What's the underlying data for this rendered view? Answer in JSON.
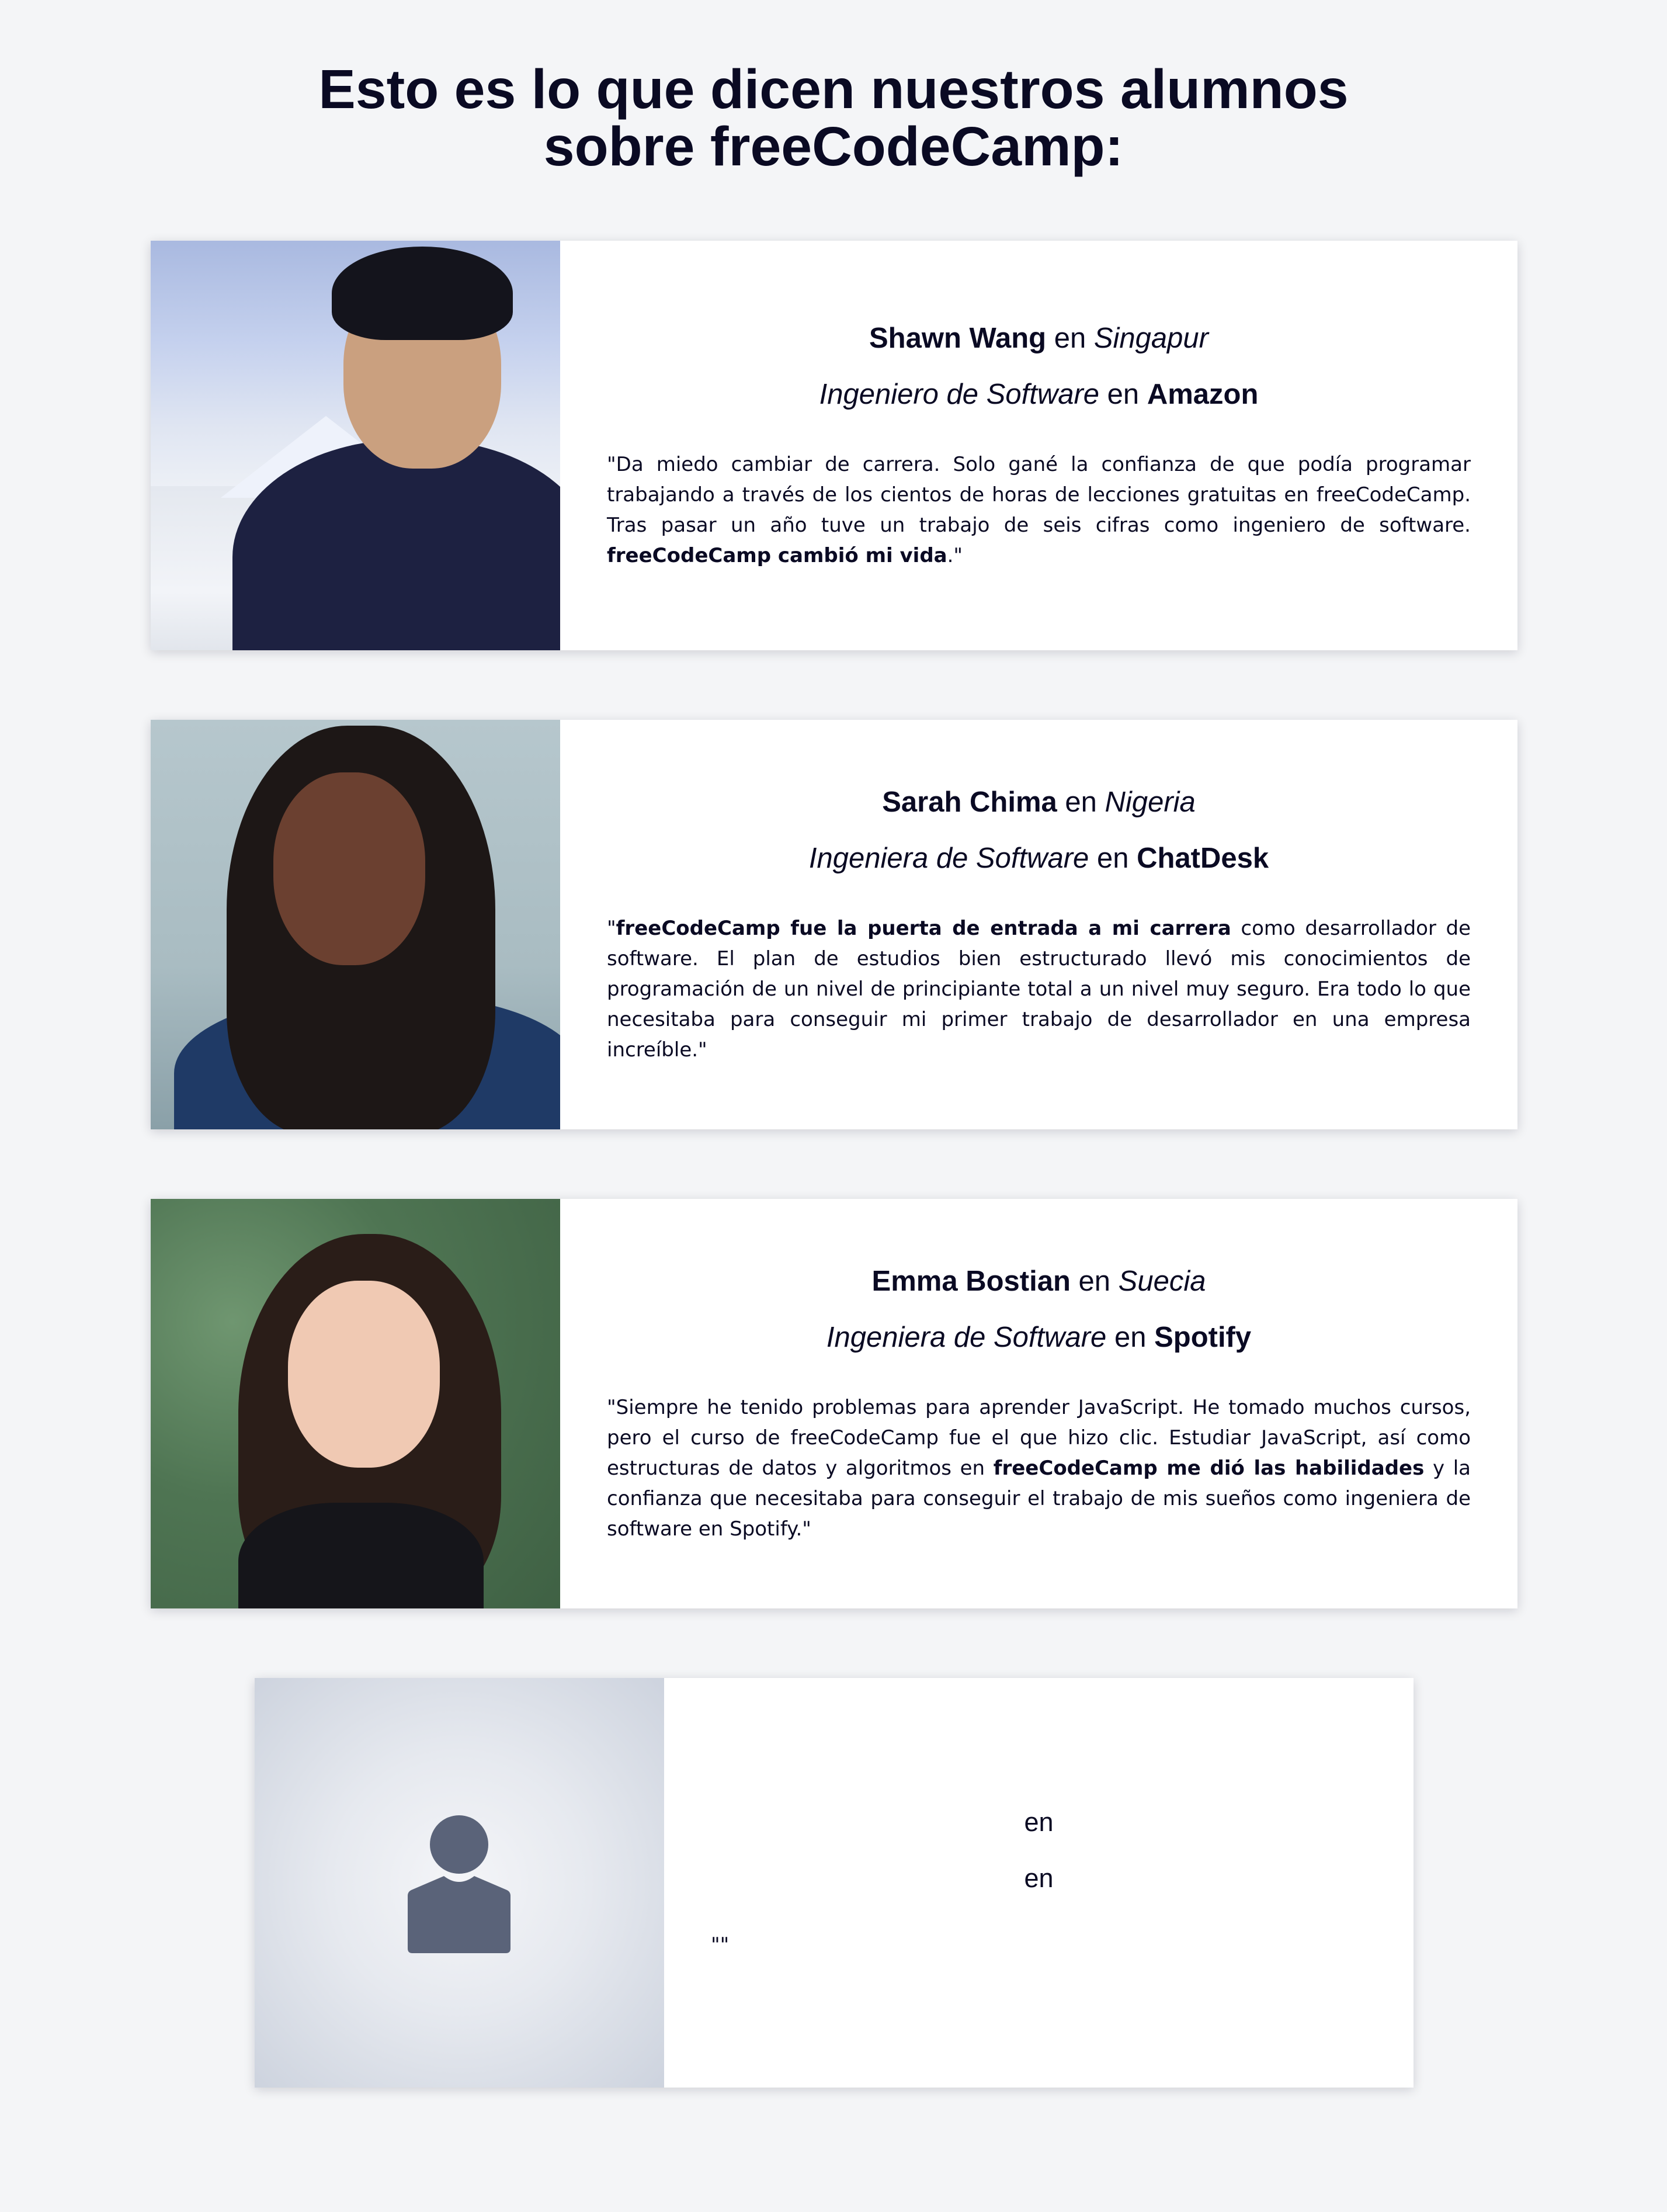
{
  "heading": {
    "line1": "Esto es lo que dicen nuestros alumnos",
    "line2": "sobre freeCodeCamp:"
  },
  "connector": "en",
  "testimonials": [
    {
      "name": "Shawn Wang",
      "location": "Singapur",
      "role": "Ingeniero de Software",
      "company": "Amazon",
      "quote_open": "\"",
      "quote_before": "Da miedo cambiar de carrera. Solo gané la confianza de que podía programar trabajando a través de los cientos de horas de lecciones gratuitas en freeCodeCamp. Tras pasar un año tuve un trabajo de seis cifras como ingeniero de software. ",
      "quote_bold": "freeCodeCamp cambió mi vida",
      "quote_after": ".\""
    },
    {
      "name": "Sarah Chima",
      "location": "Nigeria",
      "role": "Ingeniera de Software",
      "company": "ChatDesk",
      "quote_open": "\"",
      "quote_bold": "freeCodeCamp fue la puerta de entrada a mi carrera",
      "quote_after": " como desarrollador de software. El plan de estudios bien estructurado llevó mis conocimientos de programación de un nivel de principiante total a un nivel muy seguro. Era todo lo que necesitaba para conseguir mi primer trabajo de desarrollador en una empresa increíble.\""
    },
    {
      "name": "Emma Bostian",
      "location": "Suecia",
      "role": "Ingeniera de Software",
      "company": "Spotify",
      "quote_before": "\"Siempre he tenido problemas para aprender JavaScript. He tomado muchos cursos, pero el curso de freeCodeCamp fue el que hizo clic. Estudiar JavaScript, así como estructuras de datos y algoritmos en ",
      "quote_bold": "freeCodeCamp me dió las habilidades",
      "quote_after": " y la confianza que necesitaba para conseguir el trabajo de mis sueños como ingeniera de software en Spotify.\""
    },
    {
      "line1": "en",
      "line2": "en",
      "quote": "\"\""
    }
  ],
  "icons": {
    "placeholder": "user-avatar-icon"
  },
  "colors": {
    "background": "#f4f5f7",
    "text": "#0a0a23",
    "card": "#ffffff",
    "placeholder_icon": "#5a6379"
  }
}
